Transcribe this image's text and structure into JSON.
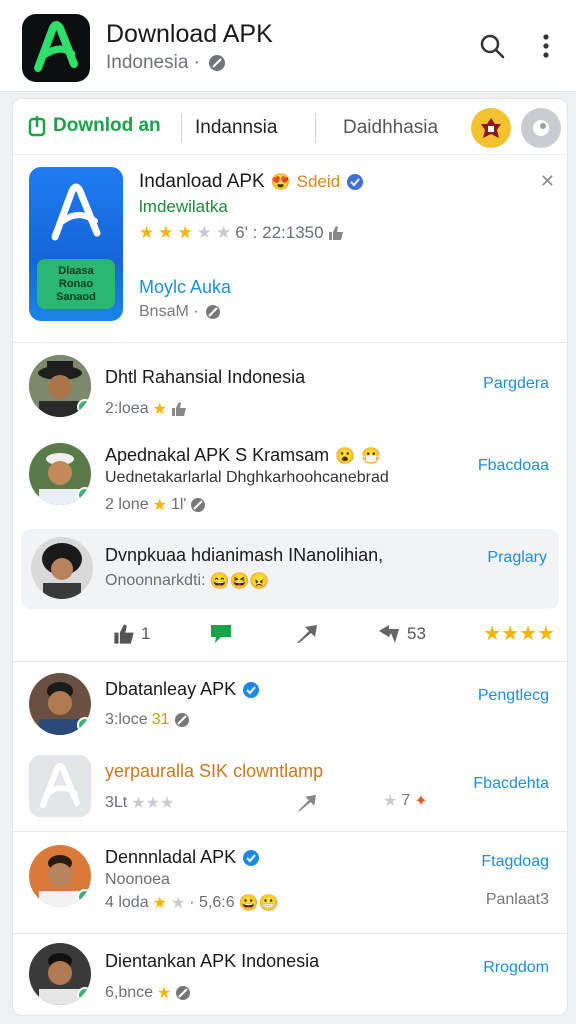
{
  "appbar": {
    "title": "Download APK",
    "subtitle": "Indonesia · "
  },
  "filters": {
    "active": "Downlod an",
    "second": "Indannsia",
    "third": "Daidhhasia"
  },
  "detail": {
    "title": "Indanload APK",
    "tag": "Sdeid",
    "developer": "lmdewilatka",
    "rating_text": "6' : 22:1350",
    "stars_filled": 3,
    "link": "Moylc Auka",
    "size": "BnsaM ·",
    "icon_text_1": "Dlaasa ",
    "icon_text_2": "Ronao",
    "icon_text_3": "Sanaod"
  },
  "reviews": [
    {
      "name": "Dhtl Rahansial Indonesia",
      "meta": "2:loea",
      "action": "Pargdera"
    },
    {
      "name": "Apednakal APK S Kramsam",
      "line2": "Uednetakarlarlal Dhghkarhoohcanebrad",
      "meta": "2 lone",
      "meta2": "1l'",
      "action": "Fbacdoaa"
    },
    {
      "name": "Dvnpkuaa hdianimash INanolihian,",
      "meta": "Onoonnarkdti:",
      "action": "Praglary"
    },
    {
      "name": "Dbatanleay APK",
      "meta": "3:loce",
      "meta2": "31",
      "action": "Pengtlecg"
    },
    {
      "name": "yerpauralla SIK clowntlamp",
      "meta": "3Lt",
      "meta2": "7",
      "action": "Fbacdehta"
    },
    {
      "name": "Dennnladal APK",
      "line2": "Noonoea",
      "meta": "4 loda",
      "meta2": "· 5,6:6",
      "action": "Ftagdoag",
      "action2": "Panlaat3"
    },
    {
      "name": "Dientankan APK Indonesia",
      "meta": "6,bnce",
      "action": "Rrogdom"
    }
  ],
  "action_bar": {
    "like_count": "1",
    "retweet_count": "53"
  }
}
